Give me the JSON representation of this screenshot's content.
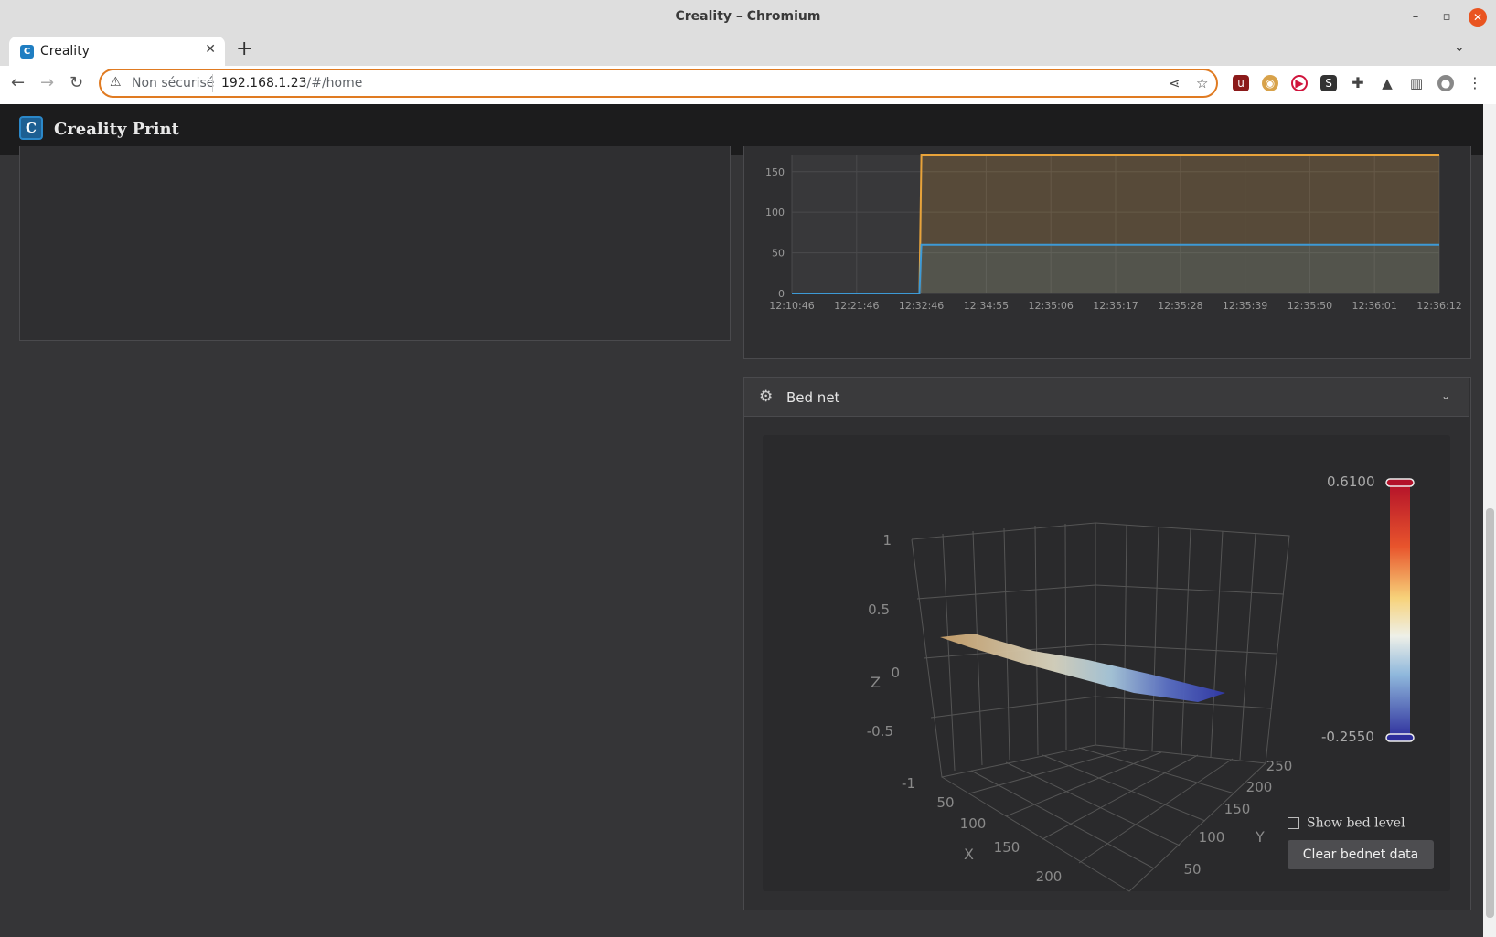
{
  "window": {
    "title": "Creality – Chromium"
  },
  "browser": {
    "tab_title": "Creality",
    "security_label": "Non sécurisé",
    "url_host": "192.168.1.23",
    "url_path": "/#/home"
  },
  "app": {
    "name": "Creality Print",
    "logo_letter": "C"
  },
  "temp_chart": {
    "type": "line",
    "y_ticks": [
      "150",
      "100",
      "50",
      "0"
    ],
    "x_ticks": [
      "12:10:46",
      "12:21:46",
      "12:32:46",
      "12:34:55",
      "12:35:06",
      "12:35:17",
      "12:35:28",
      "12:35:39",
      "12:35:50",
      "12:36:01",
      "12:36:12"
    ],
    "colors": {
      "orange": "#e8a33a",
      "blue": "#3d9ad6"
    }
  },
  "bed_net": {
    "title": "Bed net",
    "z_label": "Z",
    "x_label": "X",
    "y_label": "Y",
    "z_ticks": [
      "1",
      "0.5",
      "0",
      "-0.5",
      "-1"
    ],
    "x_ticks": [
      "50",
      "100",
      "150",
      "200"
    ],
    "y_ticks": [
      "50",
      "100",
      "150",
      "200",
      "250"
    ],
    "colorbar": {
      "max": "0.6100",
      "min": "-0.2550"
    },
    "show_bed_level_label": "Show bed level",
    "clear_button": "Clear bednet data"
  },
  "chart_data": {
    "type": "line",
    "x": [
      "12:10:46",
      "12:21:46",
      "12:32:46",
      "12:34:55",
      "12:35:06",
      "12:35:17",
      "12:35:28",
      "12:35:39",
      "12:35:50",
      "12:36:01",
      "12:36:12"
    ],
    "ylim": [
      0,
      170
    ],
    "series": [
      {
        "color": "#e8a33a",
        "values": [
          0,
          0,
          170,
          170,
          170,
          170,
          170,
          170,
          170,
          170,
          170
        ]
      },
      {
        "color": "#3d9ad6",
        "values": [
          0,
          0,
          60,
          60,
          60,
          60,
          60,
          60,
          60,
          60,
          60
        ]
      }
    ]
  }
}
